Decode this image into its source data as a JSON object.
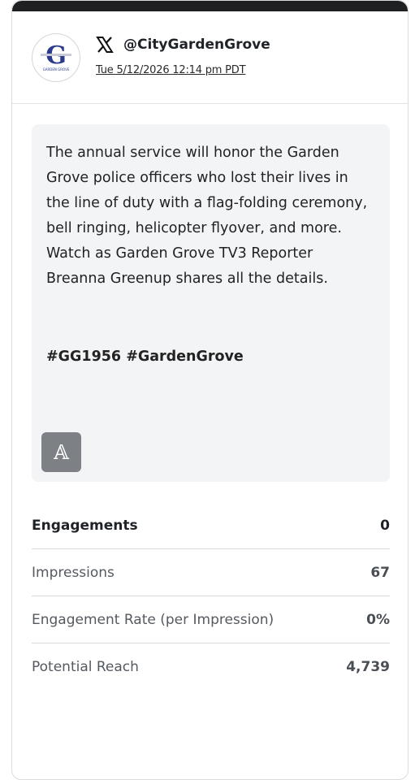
{
  "post": {
    "platform_icon": "x-logo-icon",
    "handle": "@CityGardenGrove",
    "timestamp": "Tue 5/12/2026 12:14 pm PDT",
    "avatar_text": "G",
    "avatar_caption": "GARDEN GROVE",
    "body": "The annual service will honor the Garden Grove police officers who lost their lives in the line of duty with a flag-folding ceremony, bell ringing, helicopter flyover, and more. Watch as Garden Grove TV3 Reporter Breanna Greenup shares all the details.",
    "hashtags": "#GG1956 #GardenGrove",
    "badge_glyph": "𝔸"
  },
  "metrics": [
    {
      "label": "Engagements",
      "value": "0"
    },
    {
      "label": "Impressions",
      "value": "67"
    },
    {
      "label": "Engagement Rate (per Impression)",
      "value": "0%"
    },
    {
      "label": "Potential Reach",
      "value": "4,739"
    }
  ],
  "colors": {
    "topbar": "#1f2022",
    "post_bg": "#f3f4f6",
    "badge_bg": "#7d8084",
    "avatar_logo": "#2b3a8c"
  }
}
